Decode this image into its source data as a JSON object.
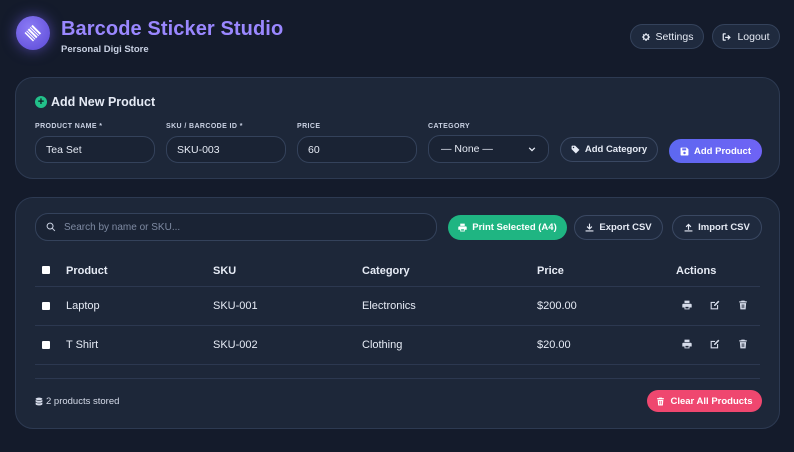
{
  "app": {
    "title": "Barcode Sticker Studio",
    "subtitle": "Personal Digi Store",
    "logo_icon": "barcode-icon",
    "accent_color": "#9a87ff"
  },
  "header": {
    "settings_label": "Settings",
    "logout_label": "Logout"
  },
  "add_product": {
    "title": "Add New Product",
    "fields": {
      "name_label": "PRODUCT NAME *",
      "name_value": "Tea Set",
      "sku_label": "SKU / BARCODE ID *",
      "sku_value": "SKU-003",
      "price_label": "PRICE",
      "price_value": "60",
      "category_label": "CATEGORY",
      "category_value": "— None —"
    },
    "add_category_label": "Add Category",
    "add_product_label": "Add Product"
  },
  "list": {
    "search_placeholder": "Search by name or SKU...",
    "print_selected_label": "Print Selected (A4)",
    "export_csv_label": "Export CSV",
    "import_csv_label": "Import CSV",
    "columns": {
      "product": "Product",
      "sku": "SKU",
      "category": "Category",
      "price": "Price",
      "actions": "Actions"
    },
    "rows": [
      {
        "product": "Laptop",
        "sku": "SKU-001",
        "category": "Electronics",
        "price": "$200.00"
      },
      {
        "product": "T Shirt",
        "sku": "SKU-002",
        "category": "Clothing",
        "price": "$20.00"
      }
    ],
    "footer_text": "2 products stored",
    "clear_all_label": "Clear All Products"
  },
  "colors": {
    "background": "#141b2b",
    "card": "#1d2739",
    "primary": "#5d68f0",
    "green": "#1fb582",
    "red": "#ef476f"
  }
}
